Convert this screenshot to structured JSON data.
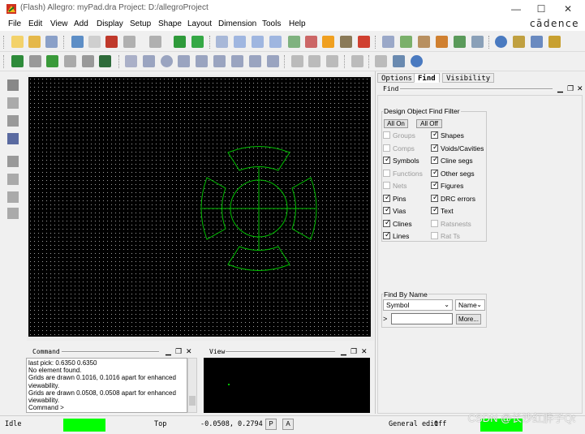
{
  "window": {
    "title": "(Flash) Allegro: myPad.dra  Project: D:/allegroProject",
    "minimize": "—",
    "maximize": "☐",
    "close": "✕",
    "brand": "cādence"
  },
  "menu": [
    "File",
    "Edit",
    "View",
    "Add",
    "Display",
    "Setup",
    "Shape",
    "Layout",
    "Dimension",
    "Tools",
    "Help"
  ],
  "right_panel": {
    "tabs": [
      "Options",
      "Find",
      "Visibility"
    ],
    "active_tab": "Find",
    "find_panel_title": "Find",
    "filter_title": "Design Object Find Filter",
    "all_on": "All On",
    "all_off": "All Off",
    "left_filters": [
      {
        "label": "Groups",
        "checked": false,
        "enabled": false
      },
      {
        "label": "Comps",
        "checked": false,
        "enabled": false
      },
      {
        "label": "Symbols",
        "checked": true,
        "enabled": true
      },
      {
        "label": "Functions",
        "checked": false,
        "enabled": false
      },
      {
        "label": "Nets",
        "checked": false,
        "enabled": false
      },
      {
        "label": "Pins",
        "checked": true,
        "enabled": true
      },
      {
        "label": "Vias",
        "checked": true,
        "enabled": true
      },
      {
        "label": "Clines",
        "checked": true,
        "enabled": true
      },
      {
        "label": "Lines",
        "checked": true,
        "enabled": true
      }
    ],
    "right_filters": [
      {
        "label": "Shapes",
        "checked": true,
        "enabled": true
      },
      {
        "label": "Voids/Cavities",
        "checked": true,
        "enabled": true
      },
      {
        "label": "Cline segs",
        "checked": true,
        "enabled": true
      },
      {
        "label": "Other segs",
        "checked": true,
        "enabled": true
      },
      {
        "label": "Figures",
        "checked": true,
        "enabled": true
      },
      {
        "label": "DRC errors",
        "checked": true,
        "enabled": true
      },
      {
        "label": "Text",
        "checked": true,
        "enabled": true
      },
      {
        "label": "Ratsnests",
        "checked": false,
        "enabled": false
      },
      {
        "label": "Rat Ts",
        "checked": false,
        "enabled": false
      }
    ],
    "find_by_name_title": "Find By Name",
    "object_type": "Symbol",
    "name_mode": "Name",
    "name_prompt": ">",
    "name_value": "",
    "more_button": "More..."
  },
  "command": {
    "title": "Command",
    "lines": [
      "last pick:  0.6350 0.6350",
      "No element found.",
      "Grids are drawn 0.1016, 0.1016 apart for enhanced",
      "viewability.",
      "Grids are drawn 0.0508, 0.0508 apart for enhanced",
      "viewability.",
      "Command >"
    ]
  },
  "view": {
    "title": "View"
  },
  "status": {
    "state": "Idle",
    "layer": "Top",
    "coordinates": "-0.0508, 0.2794",
    "p_button": "P",
    "a_button": "A",
    "mode": "General edit",
    "off_label": "Off"
  },
  "watermark": "CSDN @长沙红胖子Qt",
  "colors": {
    "drawing": "#00c000",
    "status_green": "#00ff00",
    "canvas_bg": "#000000"
  }
}
